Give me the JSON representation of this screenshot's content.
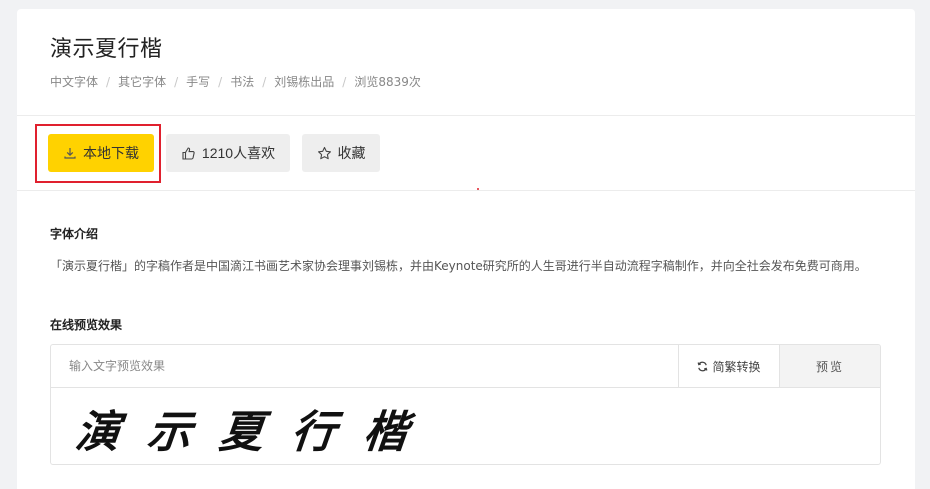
{
  "header": {
    "title": "演示夏行楷",
    "breadcrumb": [
      "中文字体",
      "其它字体",
      "手写",
      "书法",
      "刘锡栋出品"
    ],
    "views": "浏览8839次"
  },
  "actions": {
    "download_label": "本地下载",
    "like_label": "1210人喜欢",
    "favorite_label": "收藏",
    "download_color": "#ffd200",
    "highlight_color": "#e0202e"
  },
  "intro": {
    "title": "字体介绍",
    "text": "「演示夏行楷」的字稿作者是中国滴江书画艺术家协会理事刘锡栋，并由Keynote研究所的人生哥进行半自动流程字稿制作，并向全社会发布免费可商用。"
  },
  "preview": {
    "title": "在线预览效果",
    "input_placeholder": "输入文字预览效果",
    "convert_label": "简繁转换",
    "preview_label": "预览",
    "sample_text": "演示夏行楷"
  },
  "icons": {
    "download": "download-icon",
    "like": "thumbs-up-icon",
    "favorite": "star-icon",
    "convert": "refresh-icon"
  }
}
